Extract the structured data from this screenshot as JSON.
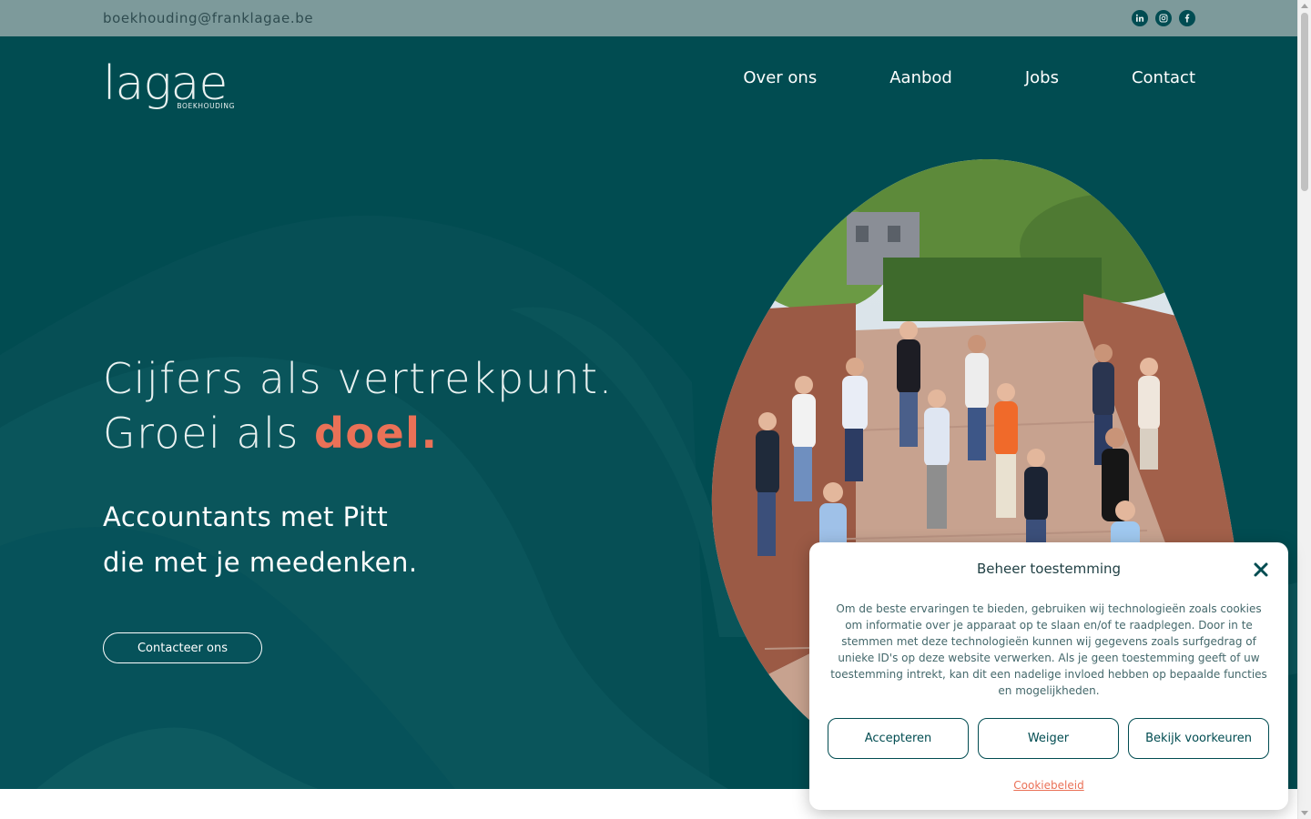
{
  "topbar": {
    "email": "boekhouding@franklagae.be",
    "socials": [
      {
        "icon": "linkedin-icon"
      },
      {
        "icon": "instagram-icon"
      },
      {
        "icon": "facebook-icon"
      }
    ]
  },
  "logo": {
    "text": "lagae",
    "subtitle": "BOEKHOUDING"
  },
  "nav": {
    "items": [
      "Over ons",
      "Aanbod",
      "Jobs",
      "Contact"
    ]
  },
  "hero": {
    "line1": "Cijfers als vertrekpunt.",
    "line2_prefix": "Groei als ",
    "line2_accent": "doel.",
    "sub1": "Accountants met Pitt",
    "sub2": "die met je meedenken.",
    "cta": "Contacteer ons"
  },
  "cookie": {
    "title": "Beheer toestemming",
    "body": "Om de beste ervaringen te bieden, gebruiken wij technologieën zoals cookies om informatie over je apparaat op te slaan en/of te raadplegen. Door in te stemmen met deze technologieën kunnen wij gegevens zoals surfgedrag of unieke ID's op deze website verwerken. Als je geen toestemming geeft of uw toestemming intrekt, kan dit een nadelige invloed hebben op bepaalde functies en mogelijkheden.",
    "accept": "Accepteren",
    "deny": "Weiger",
    "preferences": "Bekijk voorkeuren",
    "policy": "Cookiebeleid"
  },
  "colors": {
    "hero_bg": "#014c51",
    "topbar_bg": "#7d9a9b",
    "accent": "#ea7157"
  }
}
